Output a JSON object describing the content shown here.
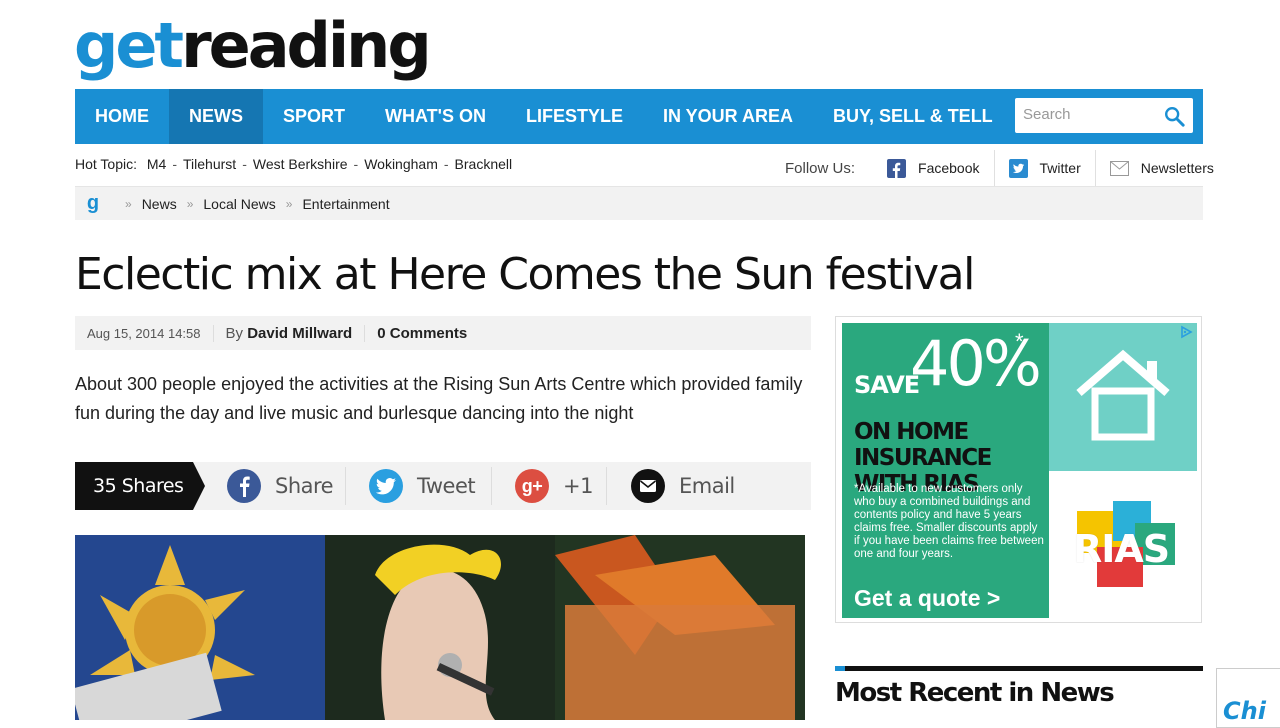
{
  "logo": {
    "part1": "get",
    "part2": "reading"
  },
  "nav": {
    "items": [
      "HOME",
      "NEWS",
      "SPORT",
      "WHAT'S ON",
      "LIFESTYLE",
      "IN YOUR AREA",
      "BUY, SELL & TELL"
    ],
    "active": "NEWS",
    "search_placeholder": "Search"
  },
  "hot_topic": {
    "label": "Hot Topic:",
    "items": [
      "M4",
      "Tilehurst",
      "West Berkshire",
      "Wokingham",
      "Bracknell"
    ],
    "separator": "-"
  },
  "follow": {
    "label": "Follow Us:",
    "facebook": "Facebook",
    "twitter": "Twitter",
    "newsletters": "Newsletters"
  },
  "breadcrumb": {
    "logo": "g",
    "separator": "»",
    "items": [
      "News",
      "Local News",
      "Entertainment"
    ]
  },
  "article": {
    "headline": "Eclectic mix at Here Comes the Sun festival",
    "date": "Aug 15, 2014 14:58",
    "by_label": "By",
    "author": "David Millward",
    "comments_count": "0",
    "comments_label": "Comments",
    "standfirst": "About 300 people enjoyed the activities at the Rising Sun Arts Centre which provided family fun during the day and live music and burlesque dancing into the night"
  },
  "share": {
    "count_label": "35 Shares",
    "facebook": "Share",
    "twitter": "Tweet",
    "google": "+1",
    "email": "Email"
  },
  "ad": {
    "save": "SAVE",
    "percent": "40%",
    "asterisk": "*",
    "line1": "ON HOME INSURANCE",
    "line2": "WITH RIAS",
    "fine_print": "*Available to new customers only who buy a combined buildings and contents policy and have 5 years claims free. Smaller discounts apply if you have been claims free between one and four years.",
    "cta": "Get a quote >",
    "brand": "RIAS"
  },
  "sidebar": {
    "most_recent_title": "Most Recent in News",
    "corner_text": "Chi"
  },
  "colors": {
    "brand_blue": "#1a8fd3",
    "nav_active": "#1576b2",
    "ad_green": "#2aa87e",
    "ad_teal": "#6fd0c6"
  }
}
